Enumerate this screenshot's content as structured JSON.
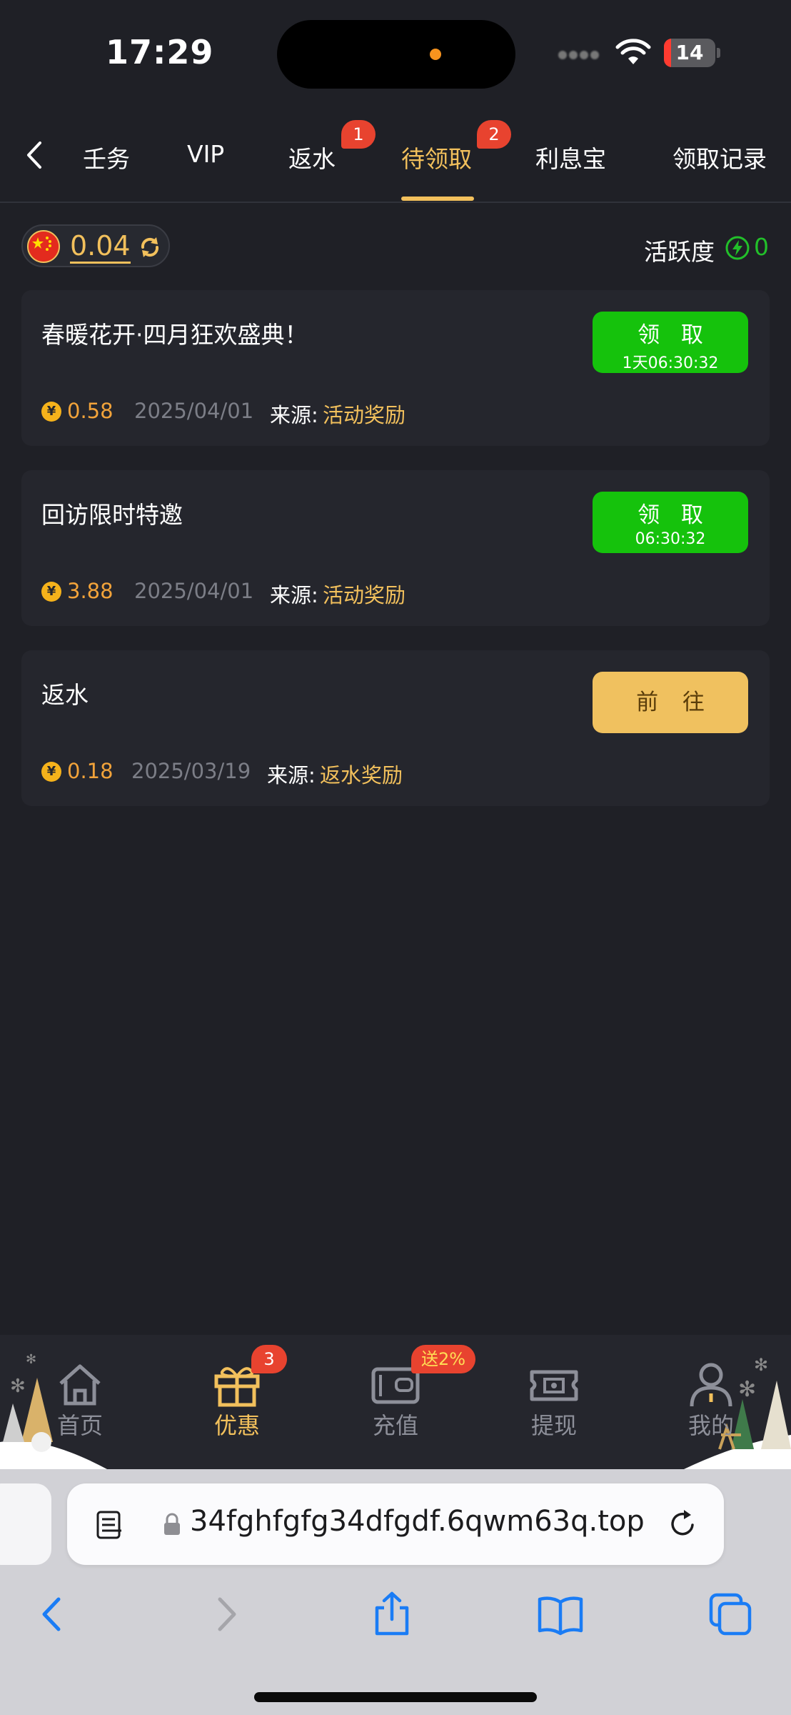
{
  "status_bar": {
    "time": "17:29",
    "battery_level": "14"
  },
  "tabs": {
    "items": [
      {
        "label": "任务",
        "visible_text": "壬务"
      },
      {
        "label": "VIP"
      },
      {
        "label": "返水",
        "badge": "1"
      },
      {
        "label": "待领取",
        "badge": "2",
        "active": true
      },
      {
        "label": "利息宝"
      },
      {
        "label": "领取记录"
      }
    ]
  },
  "balance": {
    "amount": "0.04",
    "activity_label": "活跃度",
    "activity_value": "0"
  },
  "cards": [
    {
      "title": "春暖花开·四月狂欢盛典！",
      "currency_symbol": "¥",
      "amount": "0.58",
      "date": "2025/04/01",
      "source_label": "来源:",
      "source_value": "活动奖励",
      "button_label": "领 取",
      "button_timer": "1天06:30:32"
    },
    {
      "title": "回访限时特邀",
      "currency_symbol": "¥",
      "amount": "3.88",
      "date": "2025/04/01",
      "source_label": "来源:",
      "source_value": "活动奖励",
      "button_label": "领 取",
      "button_timer": "06:30:32"
    },
    {
      "title": "返水",
      "currency_symbol": "¥",
      "amount": "0.18",
      "date": "2025/03/19",
      "source_label": "来源:",
      "source_value": "返水奖励",
      "button_label": "前 往"
    }
  ],
  "bottom_nav": {
    "items": [
      {
        "label": "首页",
        "icon": "home-icon"
      },
      {
        "label": "优惠",
        "icon": "gift-icon",
        "badge": "3",
        "active": true
      },
      {
        "label": "充值",
        "icon": "wallet-icon",
        "promo": "送2%"
      },
      {
        "label": "提现",
        "icon": "withdraw-icon"
      },
      {
        "label": "我的",
        "icon": "profile-icon"
      }
    ]
  },
  "browser": {
    "url": "34fghfgfg34dfgdf.6qwm63q.top"
  },
  "colors": {
    "background": "#1f2026",
    "card": "#25262d",
    "accent": "#f2c05c",
    "claim_green": "#15c20c",
    "badge_red": "#e8432f",
    "amount_orange": "#f2a33a"
  }
}
